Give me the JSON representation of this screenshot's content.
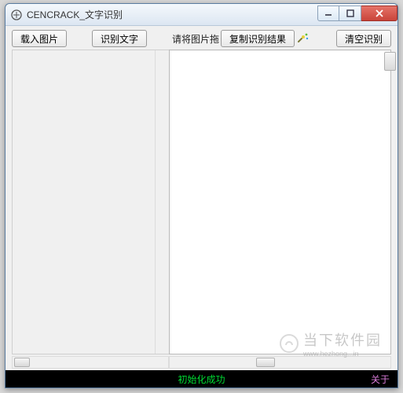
{
  "window": {
    "title": "CENCRACK_文字识别"
  },
  "toolbar": {
    "load_image": "载入图片",
    "recognize": "识别文字",
    "hint": "请将图片拖",
    "copy_result": "复制识别结果",
    "clear": "清空识别"
  },
  "status": {
    "message": "初始化成功",
    "about": "关于"
  },
  "watermark": {
    "big": "当下软件园",
    "url": "www.hezhong...in"
  }
}
